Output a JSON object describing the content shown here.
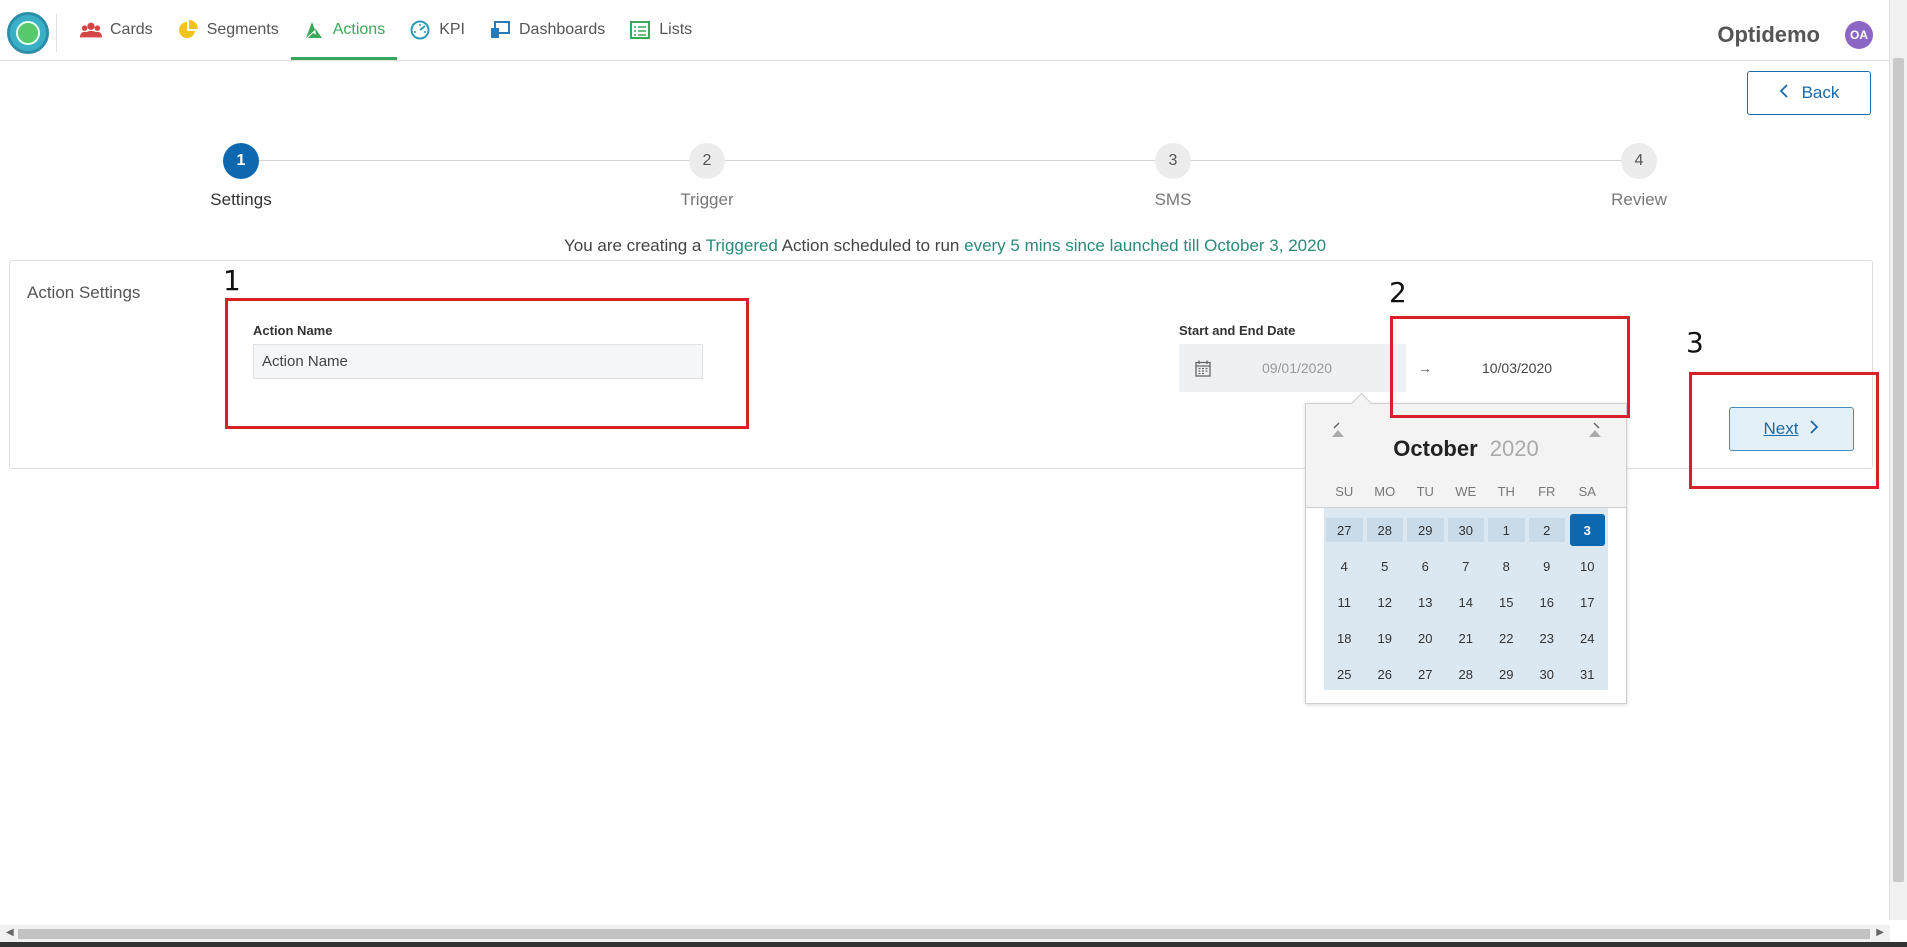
{
  "nav": {
    "items": [
      {
        "label": "Cards",
        "icon": "users-icon"
      },
      {
        "label": "Segments",
        "icon": "pie-icon"
      },
      {
        "label": "Actions",
        "icon": "actions-icon",
        "active": true
      },
      {
        "label": "KPI",
        "icon": "gauge-icon"
      },
      {
        "label": "Dashboards",
        "icon": "dashboard-icon"
      },
      {
        "label": "Lists",
        "icon": "list-icon"
      }
    ],
    "brand": "Optidemo",
    "avatar": "OA"
  },
  "back_label": "Back",
  "steps": [
    {
      "num": "1",
      "label": "Settings",
      "active": true
    },
    {
      "num": "2",
      "label": "Trigger"
    },
    {
      "num": "3",
      "label": "SMS"
    },
    {
      "num": "4",
      "label": "Review"
    }
  ],
  "schedule": {
    "prefix": "You are creating a",
    "type": "Triggered",
    "middle": "Action scheduled to run",
    "frequency": "every 5 mins since launched till October 3, 2020"
  },
  "panel_title": "Action Settings",
  "action_name": {
    "label": "Action Name",
    "value": "Action Name"
  },
  "date_range": {
    "label": "Start and End Date",
    "start": "09/01/2020",
    "arrow": "→",
    "end": "10/03/2020"
  },
  "calendar": {
    "month": "October",
    "year": "2020",
    "weekdays": [
      "SU",
      "MO",
      "TU",
      "WE",
      "TH",
      "FR",
      "SA"
    ],
    "days": [
      "27",
      "28",
      "29",
      "30",
      "1",
      "2",
      "3",
      "4",
      "5",
      "6",
      "7",
      "8",
      "9",
      "10",
      "11",
      "12",
      "13",
      "14",
      "15",
      "16",
      "17",
      "18",
      "19",
      "20",
      "21",
      "22",
      "23",
      "24",
      "25",
      "26",
      "27",
      "28",
      "29",
      "30",
      "31"
    ],
    "selected": "3"
  },
  "next_label": "Next",
  "annotations": [
    "1",
    "2",
    "3"
  ],
  "colors": {
    "accent": "#0d68b0",
    "nav_active": "#3aa85a",
    "highlight": "#2a8a7a",
    "annotation": "#d9202a"
  }
}
